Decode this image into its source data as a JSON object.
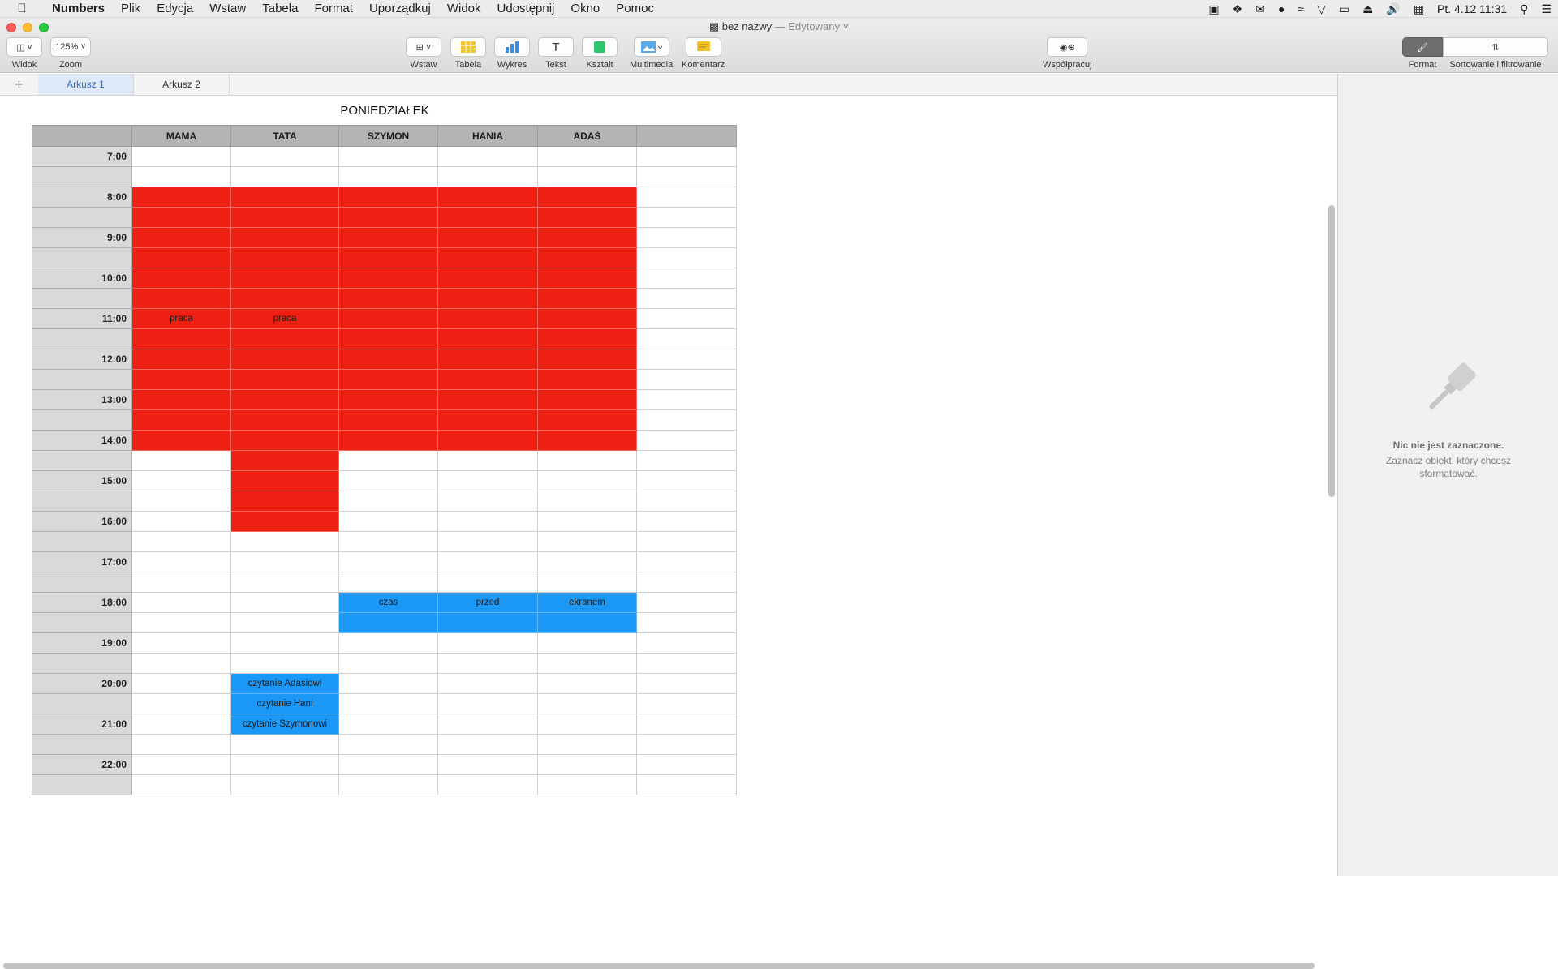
{
  "menubar": {
    "app": "Numbers",
    "items": [
      "Plik",
      "Edycja",
      "Wstaw",
      "Tabela",
      "Format",
      "Uporządkuj",
      "Widok",
      "Udostępnij",
      "Okno",
      "Pomoc"
    ],
    "clock": "Pt. 4.12  11:31"
  },
  "window": {
    "title": "bez nazwy",
    "title_status": " — Edytowany ˅"
  },
  "toolbar": {
    "view_label": "Widok",
    "zoom_value": "125% ˅",
    "zoom_label": "Zoom",
    "insert_label": "Wstaw",
    "table_label": "Tabela",
    "chart_label": "Wykres",
    "text_label": "Tekst",
    "shape_label": "Kształt",
    "media_label": "Multimedia",
    "comment_label": "Komentarz",
    "collaborate_label": "Współpracuj",
    "format_label": "Format",
    "sort_label": "Sortowanie i filtrowanie"
  },
  "sheets": {
    "add": "+",
    "tabs": [
      "Arkusz 1",
      "Arkusz 2"
    ]
  },
  "table": {
    "title": "PONIEDZIAŁEK",
    "headers": [
      "",
      "MAMA",
      "TATA",
      "SZYMON",
      "HANIA",
      "ADAŚ",
      ""
    ],
    "rows": [
      {
        "time": "7:00",
        "cells": [
          "",
          "",
          "",
          "",
          "",
          ""
        ],
        "fill": [
          "",
          "",
          "",
          "",
          "",
          ""
        ]
      },
      {
        "time": "",
        "cells": [
          "",
          "",
          "",
          "",
          "",
          ""
        ],
        "fill": [
          "",
          "",
          "",
          "",
          "",
          ""
        ]
      },
      {
        "time": "8:00",
        "cells": [
          "",
          "",
          "",
          "",
          "",
          ""
        ],
        "fill": [
          "red",
          "red",
          "red",
          "red",
          "red",
          ""
        ]
      },
      {
        "time": "",
        "cells": [
          "",
          "",
          "",
          "",
          "",
          ""
        ],
        "fill": [
          "red",
          "red",
          "red",
          "red",
          "red",
          ""
        ]
      },
      {
        "time": "9:00",
        "cells": [
          "",
          "",
          "",
          "",
          "",
          ""
        ],
        "fill": [
          "red",
          "red",
          "red",
          "red",
          "red",
          ""
        ]
      },
      {
        "time": "",
        "cells": [
          "",
          "",
          "",
          "",
          "",
          ""
        ],
        "fill": [
          "red",
          "red",
          "red",
          "red",
          "red",
          ""
        ]
      },
      {
        "time": "10:00",
        "cells": [
          "",
          "",
          "",
          "",
          "",
          ""
        ],
        "fill": [
          "red",
          "red",
          "red",
          "red",
          "red",
          ""
        ]
      },
      {
        "time": "",
        "cells": [
          "",
          "",
          "",
          "",
          "",
          ""
        ],
        "fill": [
          "red",
          "red",
          "red",
          "red",
          "red",
          ""
        ]
      },
      {
        "time": "11:00",
        "cells": [
          "praca",
          "praca",
          "",
          "",
          "",
          ""
        ],
        "fill": [
          "red",
          "red",
          "red",
          "red",
          "red",
          ""
        ]
      },
      {
        "time": "",
        "cells": [
          "",
          "",
          "",
          "",
          "",
          ""
        ],
        "fill": [
          "red",
          "red",
          "red",
          "red",
          "red",
          ""
        ]
      },
      {
        "time": "12:00",
        "cells": [
          "",
          "",
          "",
          "",
          "",
          ""
        ],
        "fill": [
          "red",
          "red",
          "red",
          "red",
          "red",
          ""
        ]
      },
      {
        "time": "",
        "cells": [
          "",
          "",
          "",
          "",
          "",
          ""
        ],
        "fill": [
          "red",
          "red",
          "red",
          "red",
          "red",
          ""
        ]
      },
      {
        "time": "13:00",
        "cells": [
          "",
          "",
          "",
          "",
          "",
          ""
        ],
        "fill": [
          "red",
          "red",
          "red",
          "red",
          "red",
          ""
        ]
      },
      {
        "time": "",
        "cells": [
          "",
          "",
          "",
          "",
          "",
          ""
        ],
        "fill": [
          "red",
          "red",
          "red",
          "red",
          "red",
          ""
        ]
      },
      {
        "time": "14:00",
        "cells": [
          "",
          "",
          "",
          "",
          "",
          ""
        ],
        "fill": [
          "red",
          "red",
          "red",
          "red",
          "red",
          ""
        ]
      },
      {
        "time": "",
        "cells": [
          "",
          "",
          "",
          "",
          "",
          ""
        ],
        "fill": [
          "",
          "red",
          "",
          "",
          "",
          ""
        ]
      },
      {
        "time": "15:00",
        "cells": [
          "",
          "",
          "",
          "",
          "",
          ""
        ],
        "fill": [
          "",
          "red",
          "",
          "",
          "",
          ""
        ]
      },
      {
        "time": "",
        "cells": [
          "",
          "",
          "",
          "",
          "",
          ""
        ],
        "fill": [
          "",
          "red",
          "",
          "",
          "",
          ""
        ]
      },
      {
        "time": "16:00",
        "cells": [
          "",
          "",
          "",
          "",
          "",
          ""
        ],
        "fill": [
          "",
          "red",
          "",
          "",
          "",
          ""
        ]
      },
      {
        "time": "",
        "cells": [
          "",
          "",
          "",
          "",
          "",
          ""
        ],
        "fill": [
          "",
          "",
          "",
          "",
          "",
          ""
        ]
      },
      {
        "time": "17:00",
        "cells": [
          "",
          "",
          "",
          "",
          "",
          ""
        ],
        "fill": [
          "",
          "",
          "",
          "",
          "",
          ""
        ]
      },
      {
        "time": "",
        "cells": [
          "",
          "",
          "",
          "",
          "",
          ""
        ],
        "fill": [
          "",
          "",
          "",
          "",
          "",
          ""
        ]
      },
      {
        "time": "18:00",
        "cells": [
          "",
          "",
          "czas",
          "przed",
          "ekranem",
          ""
        ],
        "fill": [
          "",
          "",
          "blue",
          "blue",
          "blue",
          ""
        ]
      },
      {
        "time": "",
        "cells": [
          "",
          "",
          "",
          "",
          "",
          ""
        ],
        "fill": [
          "",
          "",
          "blue",
          "blue",
          "blue",
          ""
        ]
      },
      {
        "time": "19:00",
        "cells": [
          "",
          "",
          "",
          "",
          "",
          ""
        ],
        "fill": [
          "",
          "",
          "",
          "",
          "",
          ""
        ]
      },
      {
        "time": "",
        "cells": [
          "",
          "",
          "",
          "",
          "",
          ""
        ],
        "fill": [
          "",
          "",
          "",
          "",
          "",
          ""
        ]
      },
      {
        "time": "20:00",
        "cells": [
          "",
          "czytanie Adasiowi",
          "",
          "",
          "",
          ""
        ],
        "fill": [
          "",
          "blue",
          "",
          "",
          "",
          ""
        ]
      },
      {
        "time": "",
        "cells": [
          "",
          "czytanie Hani",
          "",
          "",
          "",
          ""
        ],
        "fill": [
          "",
          "blue",
          "",
          "",
          "",
          ""
        ]
      },
      {
        "time": "21:00",
        "cells": [
          "",
          "czytanie Szymonowi",
          "",
          "",
          "",
          ""
        ],
        "fill": [
          "",
          "blue",
          "",
          "",
          "",
          ""
        ]
      },
      {
        "time": "",
        "cells": [
          "",
          "",
          "",
          "",
          "",
          ""
        ],
        "fill": [
          "",
          "",
          "",
          "",
          "",
          ""
        ]
      },
      {
        "time": "22:00",
        "cells": [
          "",
          "",
          "",
          "",
          "",
          ""
        ],
        "fill": [
          "",
          "",
          "",
          "",
          "",
          ""
        ]
      },
      {
        "time": "",
        "cells": [
          "",
          "",
          "",
          "",
          "",
          ""
        ],
        "fill": [
          "",
          "",
          "",
          "",
          "",
          ""
        ]
      }
    ]
  },
  "colors": {
    "red_fill": "#ee2014",
    "blue_fill": "#1b97f5",
    "header_gray": "#b4b4b4",
    "time_gray": "#d9d9d9"
  },
  "inspector": {
    "empty_title": "Nic nie jest zaznaczone.",
    "empty_subtitle": "Zaznacz obiekt, który chcesz sformatować."
  }
}
